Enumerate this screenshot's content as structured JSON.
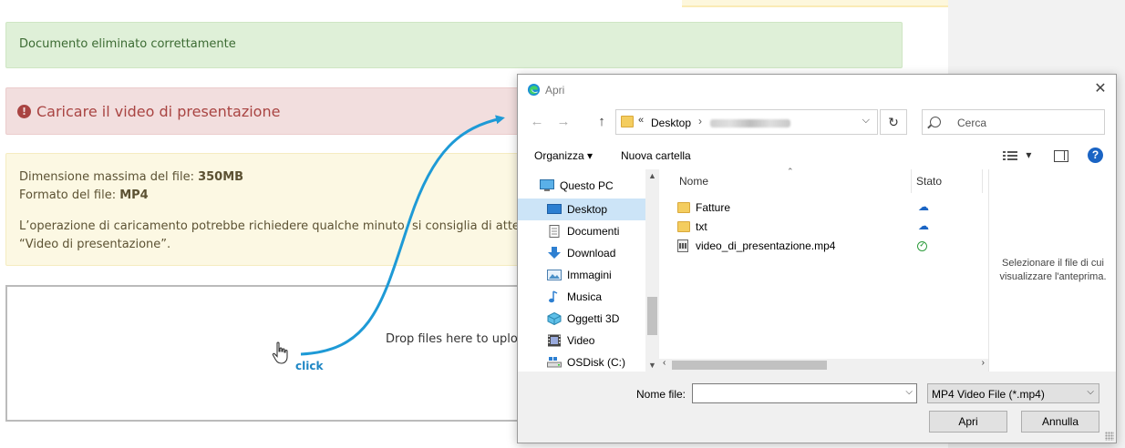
{
  "page": {
    "alerts": {
      "success": "Documento eliminato correttamente",
      "danger": "Caricare il video di presentazione",
      "warning": {
        "size_label": "Dimensione massima del file: ",
        "size_value": "350MB",
        "format_label": "Formato del file: ",
        "format_value": "MP4",
        "note_line1": "L’operazione di caricamento potrebbe richiedere qualche minuto, si consiglia di attendere",
        "note_line2": "“Video di presentazione”."
      }
    },
    "dropzone": {
      "text": "Drop files here to upload"
    },
    "annotation": {
      "click_label": "click",
      "color": "#1e86c4"
    }
  },
  "dialog": {
    "title": "Apri",
    "address": {
      "chevrons": "«",
      "segment": "Desktop",
      "separator": "›"
    },
    "search_placeholder": "Cerca",
    "toolbar": {
      "organize": "Organizza ▾",
      "new_folder": "Nuova cartella",
      "view_toggle": "▾"
    },
    "nav_items": [
      {
        "label": "Questo PC",
        "icon": "computer-icon"
      },
      {
        "label": "Desktop",
        "icon": "desktop-icon",
        "selected": true
      },
      {
        "label": "Documenti",
        "icon": "document-icon"
      },
      {
        "label": "Download",
        "icon": "download-icon"
      },
      {
        "label": "Immagini",
        "icon": "pictures-icon"
      },
      {
        "label": "Musica",
        "icon": "music-icon"
      },
      {
        "label": "Oggetti 3D",
        "icon": "3d-objects-icon"
      },
      {
        "label": "Video",
        "icon": "video-icon"
      },
      {
        "label": "OSDisk (C:)",
        "icon": "drive-icon"
      }
    ],
    "columns": {
      "name": "Nome",
      "status": "Stato"
    },
    "files": [
      {
        "name": "Fatture",
        "type": "folder",
        "status": "cloud"
      },
      {
        "name": "txt",
        "type": "folder",
        "status": "cloud"
      },
      {
        "name": "video_di_presentazione.mp4",
        "type": "video",
        "status": "available"
      }
    ],
    "preview": {
      "line1": "Selezionare il file di cui",
      "line2": "visualizzare l'anteprima."
    },
    "footer": {
      "filename_label": "Nome file:",
      "filename_value": "",
      "filter": "MP4 Video File (*.mp4)",
      "open": "Apri",
      "cancel": "Annulla"
    }
  },
  "colors": {
    "success_bg": "#dff0d8",
    "danger_bg": "#f2dede",
    "danger_text": "#a94442",
    "warning_bg": "#fcf8e3",
    "selection": "#cce4f7",
    "accent_blue": "#1a64c4"
  }
}
